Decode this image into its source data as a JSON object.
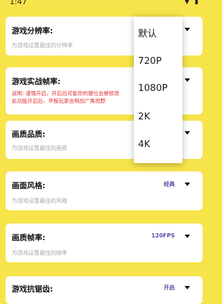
{
  "status_bar": {
    "time": "1:47",
    "icons": "▼ ▮"
  },
  "settings": [
    {
      "title": "游戏分辨率:",
      "description": "为游戏设置最佳的分辨率",
      "value": ""
    },
    {
      "title": "游戏实战帧率:",
      "warning_lines": [
        "说明: 谨慎开启，开启后可能你的键位会被修改",
        "此功能开启后，平板玩家会明加广角视野"
      ],
      "value": ""
    },
    {
      "title": "画质品质:",
      "description": "为游戏设置最佳的画质",
      "value": ""
    },
    {
      "title": "画面风格:",
      "description": "为游戏设置最佳的风格",
      "value": "经典"
    },
    {
      "title": "画质帧率:",
      "description": "为游戏设置最佳的帧率",
      "value": "120FPS"
    },
    {
      "title": "游戏抗锯齿:",
      "description": "",
      "value": "开启"
    }
  ],
  "dropdown": {
    "options": [
      "默认",
      "720P",
      "1080P",
      "2K",
      "4K"
    ]
  }
}
